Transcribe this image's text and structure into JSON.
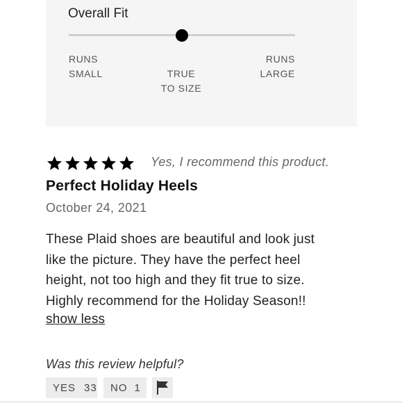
{
  "fit": {
    "title": "Overall Fit",
    "value_fraction": 0.5,
    "labels": {
      "left": "RUNS\nSMALL",
      "center": "TRUE\nTO SIZE",
      "right": "RUNS\nLARGE"
    }
  },
  "review": {
    "rating": 5,
    "rating_max": 5,
    "recommend_text": "Yes, I recommend this product.",
    "title": "Perfect Holiday Heels",
    "date": "October 24, 2021",
    "body_lines": [
      "These Plaid shoes are beautiful and look just",
      "like the picture. They have the perfect heel",
      "height, not too high and they fit true to size.",
      "Highly recommend for the Holiday Season!!"
    ],
    "show_less_label": "show less"
  },
  "helpful": {
    "question": "Was this review helpful?",
    "yes_label": "YES",
    "yes_count": "33",
    "no_label": "NO",
    "no_count": "1",
    "flag_icon": "flag-icon"
  },
  "colors": {
    "star": "#000000",
    "panel_bg": "#f5f5f5",
    "button_bg": "#ececec"
  }
}
